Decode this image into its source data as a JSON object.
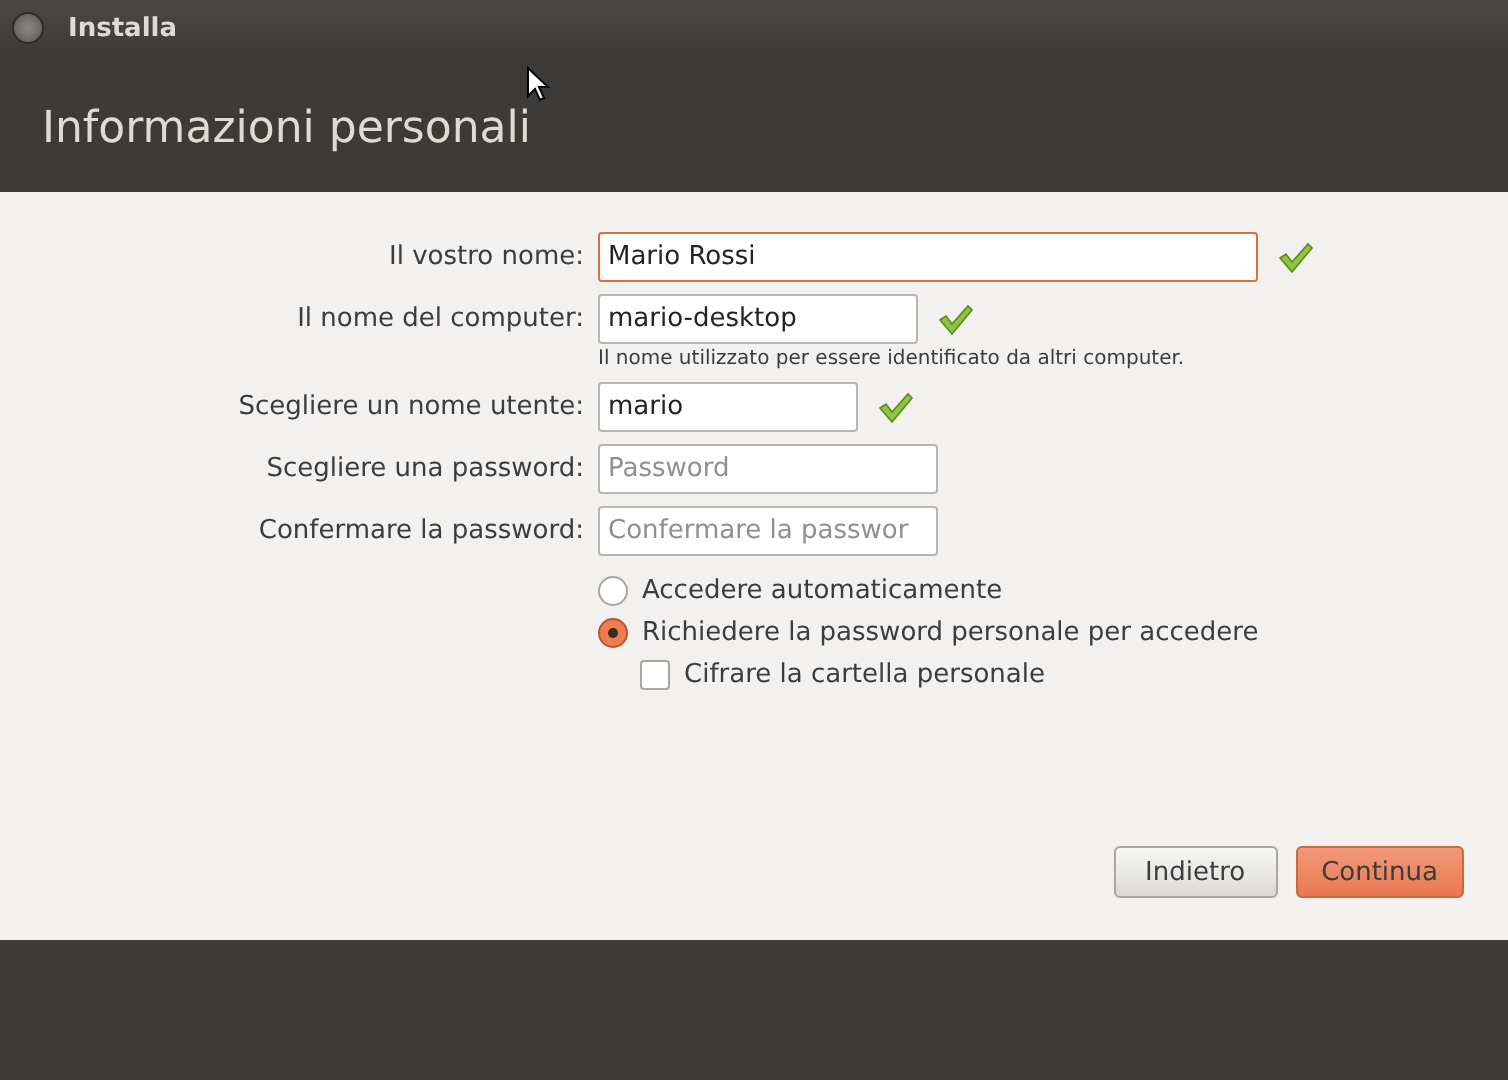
{
  "window": {
    "title": "Installa"
  },
  "header": {
    "title": "Informazioni personali"
  },
  "fields": [
    {
      "label": "Il vostro nome:",
      "value": "Mario Rossi",
      "focused": true,
      "valid": true
    },
    {
      "label": "Il nome del computer:",
      "value": "mario-desktop",
      "focused": false,
      "valid": true,
      "hint": "Il nome utilizzato per essere identificato da altri computer."
    },
    {
      "label": "Scegliere un nome utente:",
      "value": "mario",
      "focused": false,
      "valid": true
    },
    {
      "label": "Scegliere una password:",
      "placeholder": "Password",
      "focused": false,
      "valid": false
    },
    {
      "label": "Confermare la password:",
      "placeholder": "Confermare la passwor",
      "focused": false,
      "valid": false
    }
  ],
  "login_options": [
    {
      "kind": "radio",
      "label": "Accedere automaticamente",
      "selected": false
    },
    {
      "kind": "radio",
      "label": "Richiedere la password personale per accedere",
      "selected": true
    },
    {
      "kind": "checkbox",
      "label": "Cifrare la cartella personale",
      "checked": false
    }
  ],
  "buttons": [
    {
      "label": "Indietro",
      "kind": "secondary"
    },
    {
      "label": "Continua",
      "kind": "primary"
    }
  ]
}
